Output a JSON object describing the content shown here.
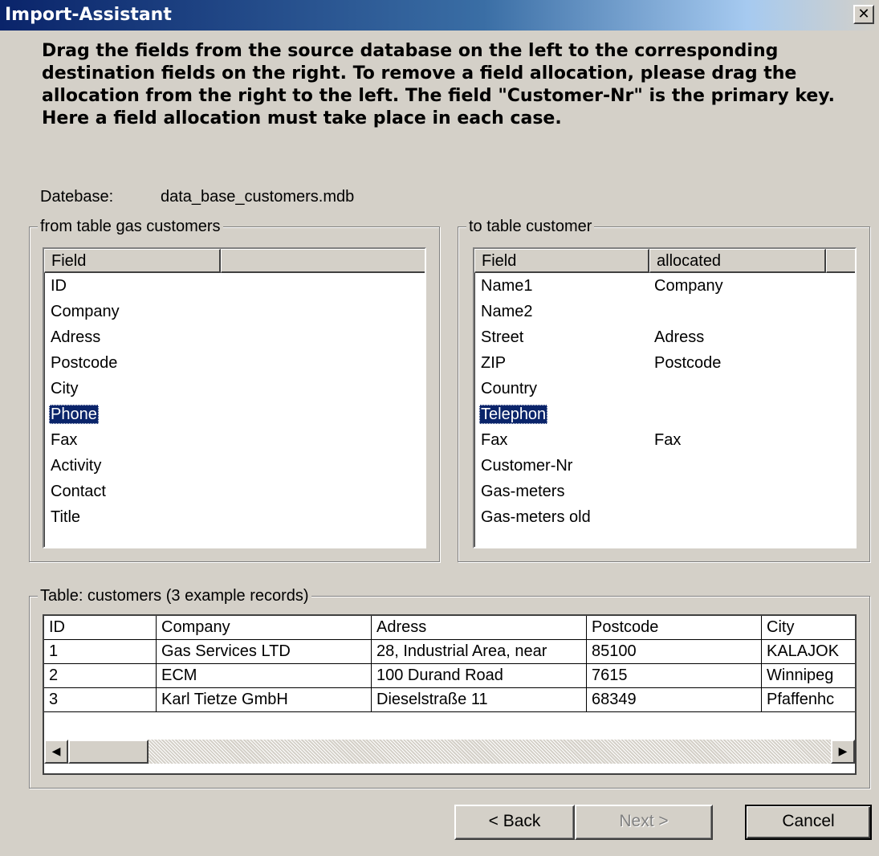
{
  "window": {
    "title": "Import-Assistant",
    "close_glyph": "✕"
  },
  "instructions": "Drag the fields from the source database on the left to the corresponding destination fields on the right. To remove a field allocation, please drag the allocation from the right to the left. The field \"Customer-Nr\" is the primary key. Here a field allocation must take place in each case.",
  "database": {
    "label": "Datebase:",
    "value": "data_base_customers.mdb"
  },
  "source": {
    "legend": "from table gas customers",
    "header_field": "Field",
    "header_extra": "",
    "fields": [
      "ID",
      "Company",
      "Adress",
      "Postcode",
      "City",
      "Phone",
      "Fax",
      "Activity",
      "Contact",
      "Title"
    ],
    "selected": "Phone"
  },
  "destination": {
    "legend": "to table customer",
    "header_field": "Field",
    "header_allocated": "allocated",
    "rows": [
      {
        "field": "Name1",
        "allocated": "Company"
      },
      {
        "field": "Name2",
        "allocated": ""
      },
      {
        "field": "Street",
        "allocated": "Adress"
      },
      {
        "field": "ZIP",
        "allocated": "Postcode"
      },
      {
        "field": "Country",
        "allocated": ""
      },
      {
        "field": "Telephon",
        "allocated": ""
      },
      {
        "field": "Fax",
        "allocated": "Fax"
      },
      {
        "field": "Customer-Nr",
        "allocated": ""
      },
      {
        "field": "Gas-meters",
        "allocated": ""
      },
      {
        "field": "Gas-meters old",
        "allocated": ""
      }
    ],
    "selected": "Telephon"
  },
  "preview": {
    "legend": "Table: customers (3 example records)",
    "columns": [
      "ID",
      "Company",
      "Adress",
      "Postcode",
      "City"
    ],
    "rows": [
      [
        "1",
        "Gas Services LTD",
        "28, Industrial Area, near",
        "85100",
        "KALAJOK"
      ],
      [
        "2",
        "ECM",
        "100 Durand Road",
        "7615",
        "Winnipeg"
      ],
      [
        "3",
        "Karl Tietze GmbH",
        "Dieselstraße 11",
        "68349",
        "Pfaffenhc"
      ]
    ],
    "scroll_left_glyph": "◀",
    "scroll_right_glyph": "▶"
  },
  "buttons": {
    "back": "< Back",
    "next": "Next >",
    "cancel": "Cancel"
  },
  "colors": {
    "dialog_bg": "#d4d0c8",
    "title_gradient_start": "#0a246a",
    "selection": "#0a246a"
  }
}
